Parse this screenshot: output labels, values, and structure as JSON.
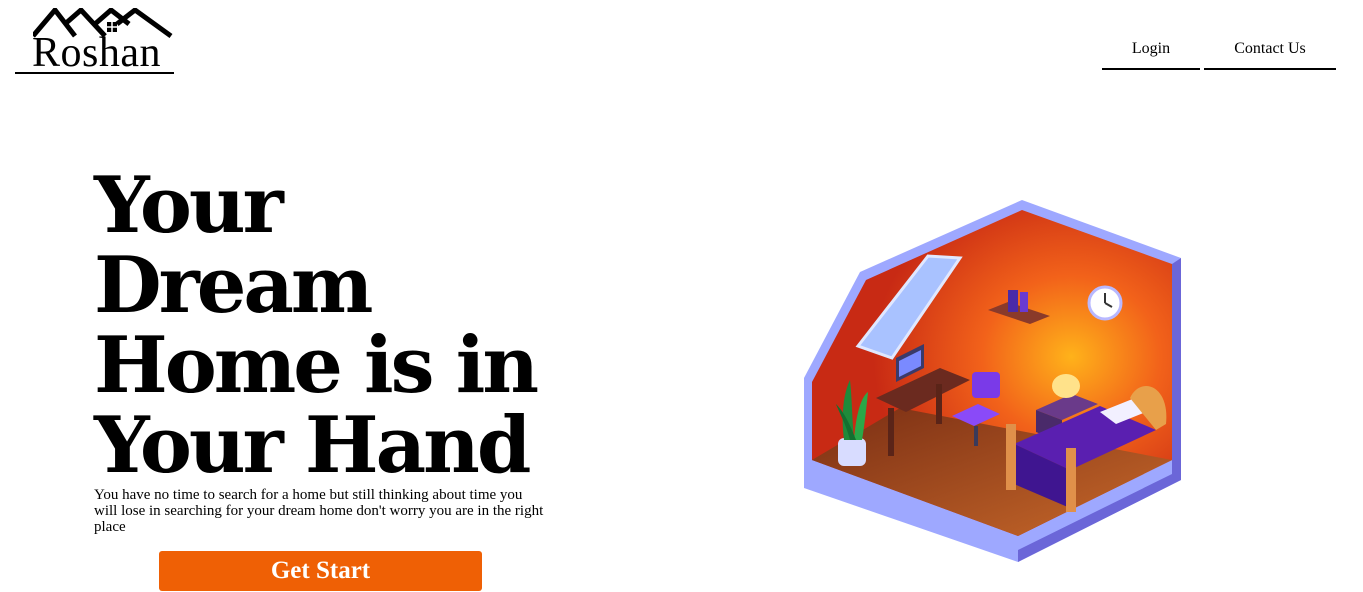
{
  "brand": {
    "name": "Roshan",
    "logo_icon": "house-roofs-icon"
  },
  "nav": {
    "items": [
      {
        "label": "Login"
      },
      {
        "label": "Contact Us"
      }
    ]
  },
  "hero": {
    "title_lines": [
      "Your",
      "Dream",
      "Home is in",
      "Your Hand"
    ],
    "description": "You have no time to search for a home but still thinking about time you will lose in searching for your dream home don't worry you are in the right place",
    "cta_label": "Get Start"
  },
  "colors": {
    "accent": "#ef6005",
    "room_wall_outer": "#9ea8ff",
    "room_wall_inner": "#d83a16",
    "room_floor": "#a8521f",
    "bed": "#5a1fb0"
  }
}
